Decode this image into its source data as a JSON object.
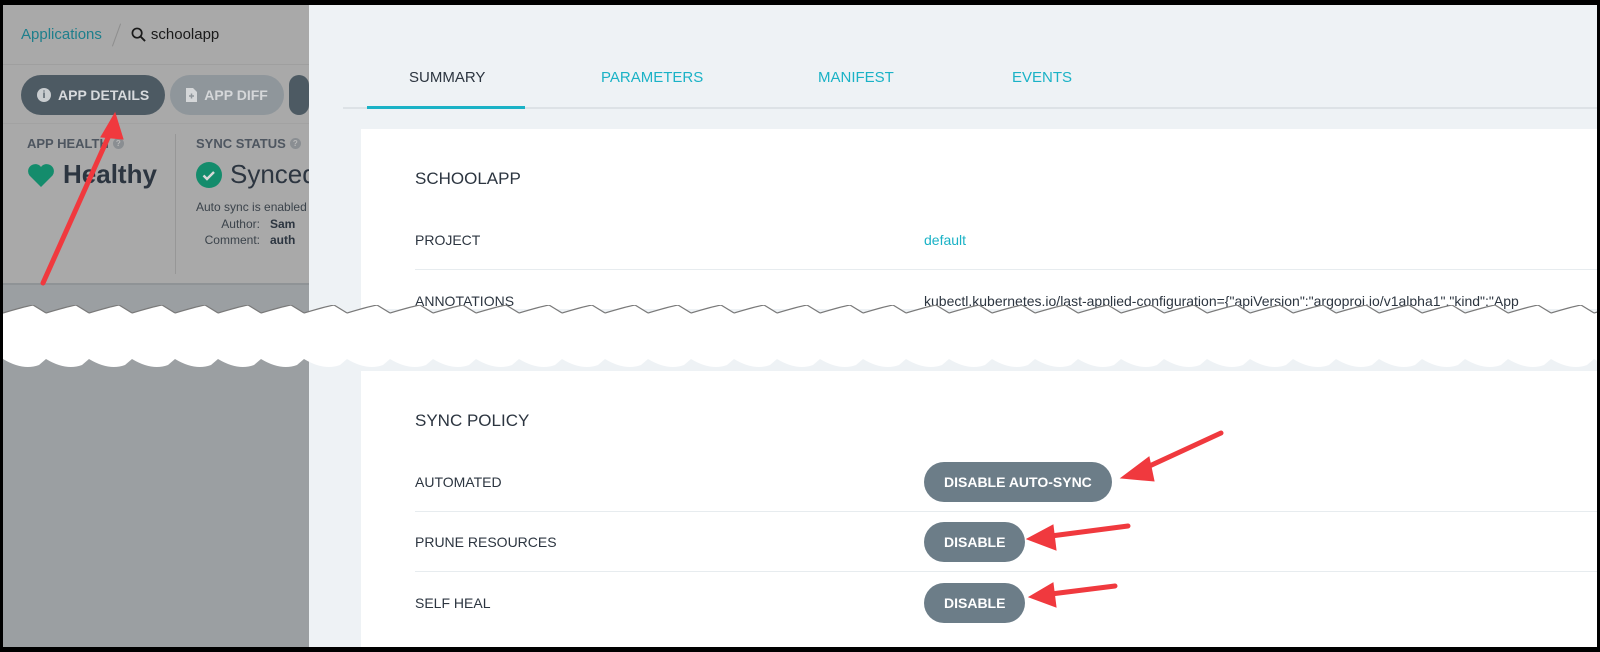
{
  "breadcrumb": {
    "root": "Applications",
    "current": "schoolapp",
    "search_icon": "search-icon"
  },
  "toolbar": {
    "app_details": "APP DETAILS",
    "app_diff": "APP DIFF"
  },
  "status": {
    "health_label": "APP HEALTH",
    "health_value": "Healthy",
    "sync_label": "SYNC STATUS",
    "sync_value": "Synced",
    "sync_info": "Auto sync is enabled",
    "author_label": "Author:",
    "author_value": "Sam",
    "comment_label": "Comment:",
    "comment_value": "auth"
  },
  "tabs": [
    {
      "label": "SUMMARY",
      "active": true
    },
    {
      "label": "PARAMETERS",
      "active": false
    },
    {
      "label": "MANIFEST",
      "active": false
    },
    {
      "label": "EVENTS",
      "active": false
    }
  ],
  "summary": {
    "title": "SCHOOLAPP",
    "rows": [
      {
        "label": "PROJECT",
        "value": "default"
      },
      {
        "label": "ANNOTATIONS",
        "value": "kubectl.kubernetes.io/last-applied-configuration={\"apiVersion\":\"argoproj.io/v1alpha1\",\"kind\":\"App"
      }
    ]
  },
  "sync_policy": {
    "title": "SYNC POLICY",
    "rows": [
      {
        "label": "AUTOMATED",
        "button": "DISABLE AUTO-SYNC"
      },
      {
        "label": "PRUNE RESOURCES",
        "button": "DISABLE"
      },
      {
        "label": "SELF HEAL",
        "button": "DISABLE"
      }
    ]
  },
  "colors": {
    "accent": "#1ab2c6",
    "healthy": "#148c6c",
    "button": "#6c7d88",
    "annotation_arrow": "#f0393e"
  }
}
